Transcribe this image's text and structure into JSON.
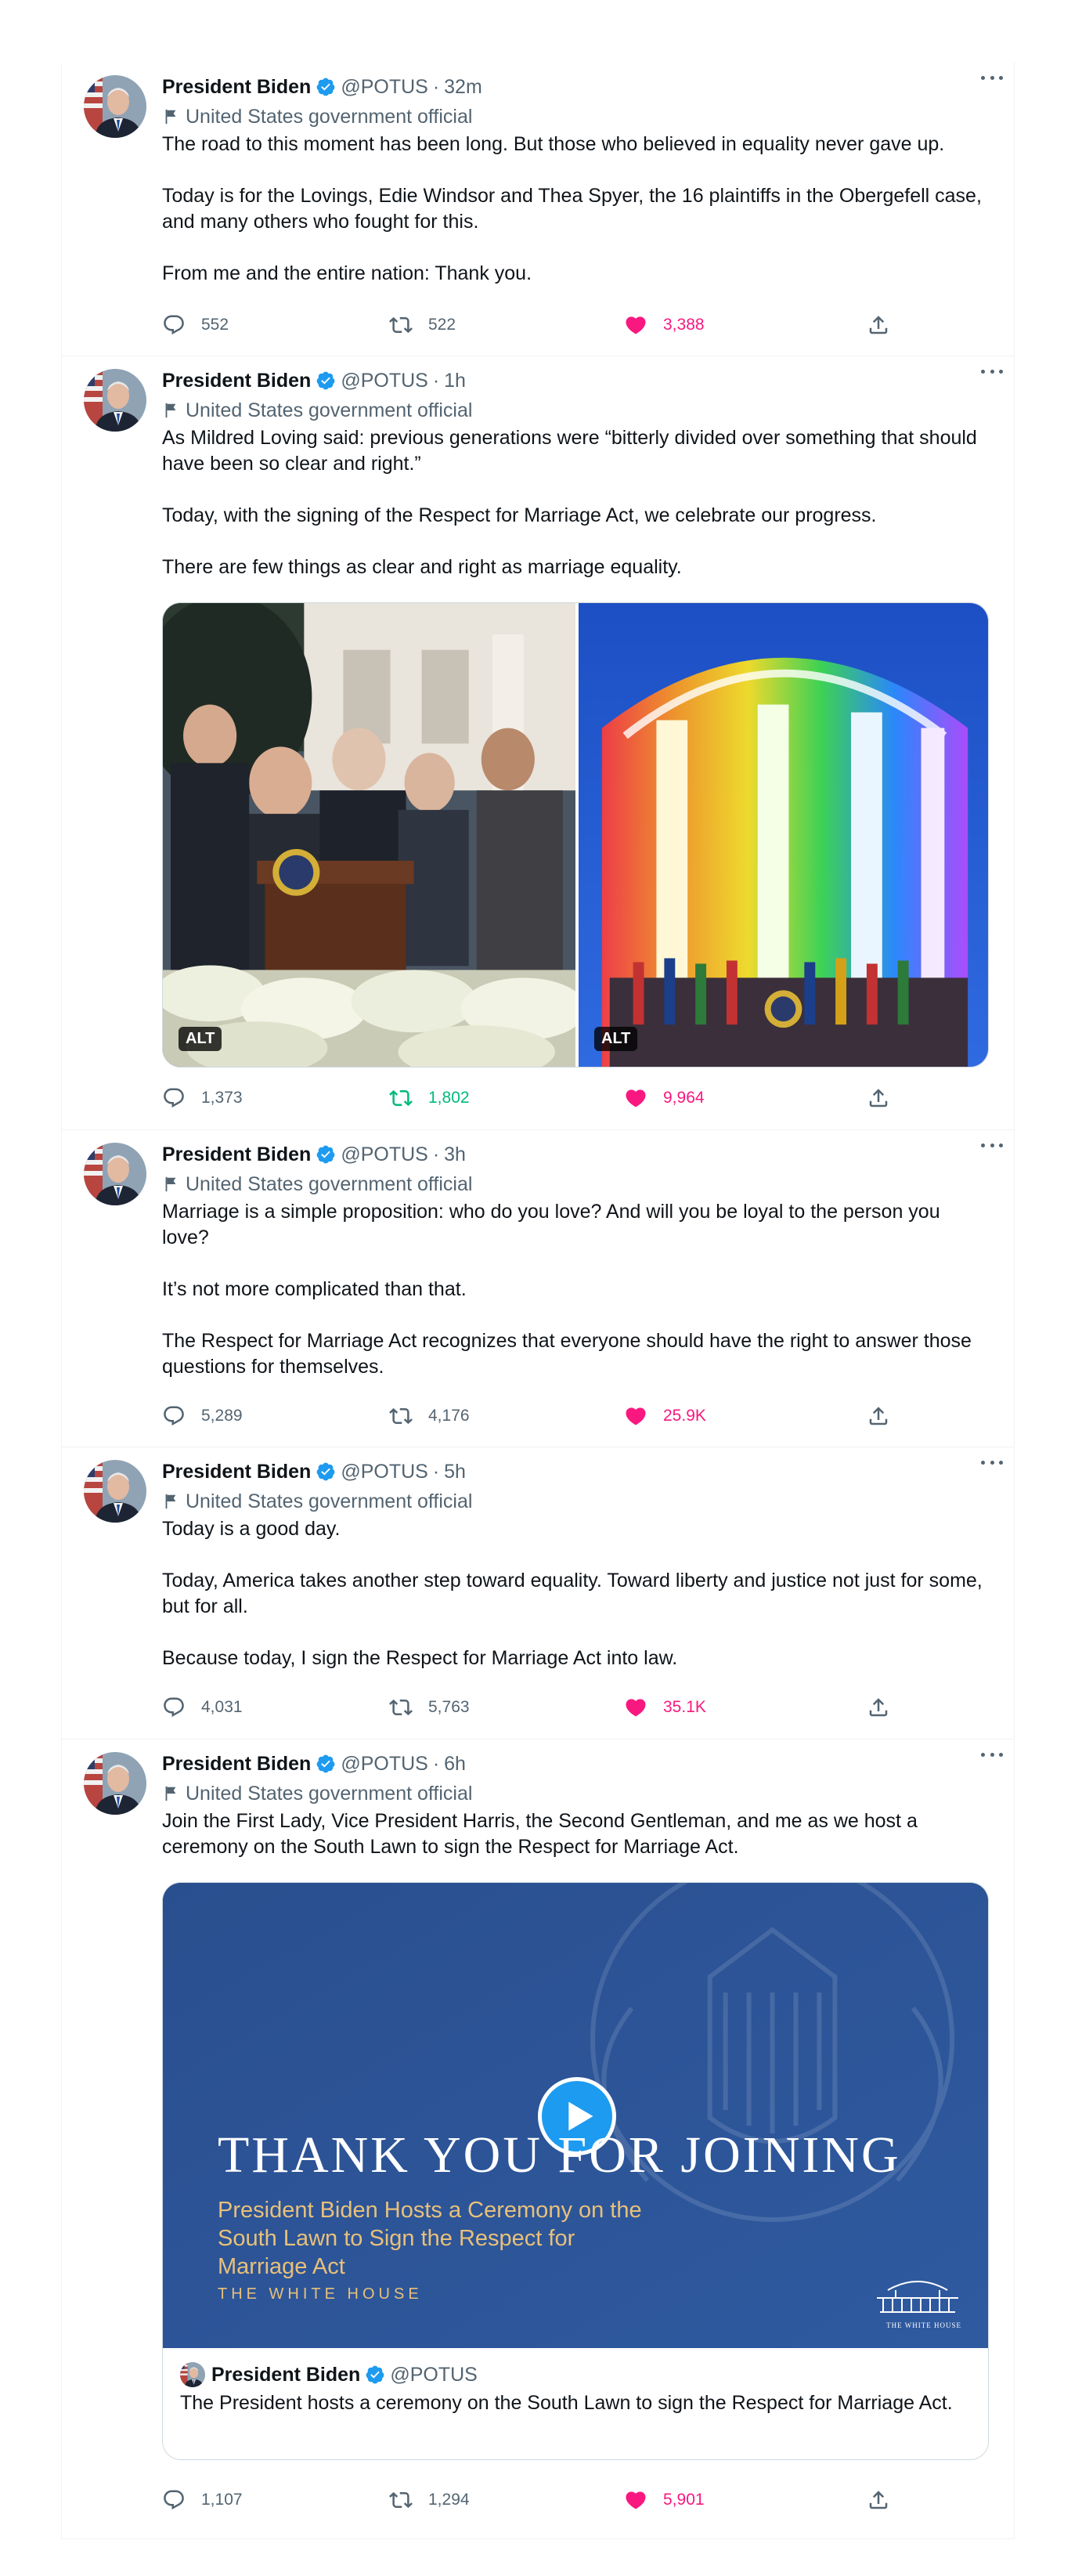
{
  "author": {
    "name": "President Biden",
    "handle": "@POTUS",
    "label": "United States government official"
  },
  "icons": {
    "verified": "verified-badge-icon",
    "label_flag": "flag-icon",
    "more": "more-icon",
    "reply": "reply-icon",
    "retweet": "retweet-icon",
    "like": "heart-icon",
    "share": "share-icon",
    "play": "play-icon"
  },
  "colors": {
    "like_active": "#f91880",
    "retweet_active": "#00ba7c",
    "verified": "#1d9bf0",
    "secondary_text": "#536471"
  },
  "separator": "·",
  "tweets": [
    {
      "time": "32m",
      "paragraphs": [
        "The road to this moment has been long. But those who believed in equality never gave up.",
        "Today is for the Lovings, Edie Windsor and Thea Spyer, the 16 plaintiffs in the Obergefell case, and many others who fought for this.",
        "From me and the entire nation: Thank you."
      ],
      "replies": "552",
      "retweets": "522",
      "likes": "3,388",
      "liked": true,
      "retweeted": false
    },
    {
      "time": "1h",
      "paragraphs": [
        "As Mildred Loving said: previous generations were “bitterly divided over something that should have been so clear and right.”",
        "Today, with the signing of the Respect for Marriage Act, we celebrate our progress.",
        "There are few things as clear and right as marriage equality."
      ],
      "media": [
        {
          "alt_badge": "ALT"
        },
        {
          "alt_badge": "ALT"
        }
      ],
      "replies": "1,373",
      "retweets": "1,802",
      "likes": "9,964",
      "liked": true,
      "retweeted": true
    },
    {
      "time": "3h",
      "paragraphs": [
        "Marriage is a simple proposition: who do you love? And will you be loyal to the person you love?",
        "It’s not more complicated than that.",
        "The Respect for Marriage Act recognizes that everyone should have the right to answer those questions for themselves."
      ],
      "replies": "5,289",
      "retweets": "4,176",
      "likes": "25.9K",
      "liked": true,
      "retweeted": false
    },
    {
      "time": "5h",
      "paragraphs": [
        "Today is a good day.",
        "Today, America takes another step toward equality. Toward liberty and justice not just for some, but for all.",
        "Because today, I sign the Respect for Marriage Act into law."
      ],
      "replies": "4,031",
      "retweets": "5,763",
      "likes": "35.1K",
      "liked": true,
      "retweeted": false
    },
    {
      "time": "6h",
      "paragraphs": [
        "Join the First Lady, Vice President Harris, the Second Gentleman, and me as we host a ceremony on the South Lawn to sign the Respect for Marriage Act."
      ],
      "video": {
        "headline": "THANK YOU FOR JOINING",
        "subtitle": "President Biden Hosts a Ceremony on the South Lawn to Sign the Respect for Marriage Act",
        "org": "THE WHITE HOUSE",
        "logo_text": "THE WHITE HOUSE"
      },
      "quote": {
        "name": "President Biden",
        "handle": "@POTUS",
        "text": "The President hosts a ceremony on the South Lawn to sign the Respect for Marriage Act."
      },
      "replies": "1,107",
      "retweets": "1,294",
      "likes": "5,901",
      "liked": true,
      "retweeted": false
    }
  ]
}
